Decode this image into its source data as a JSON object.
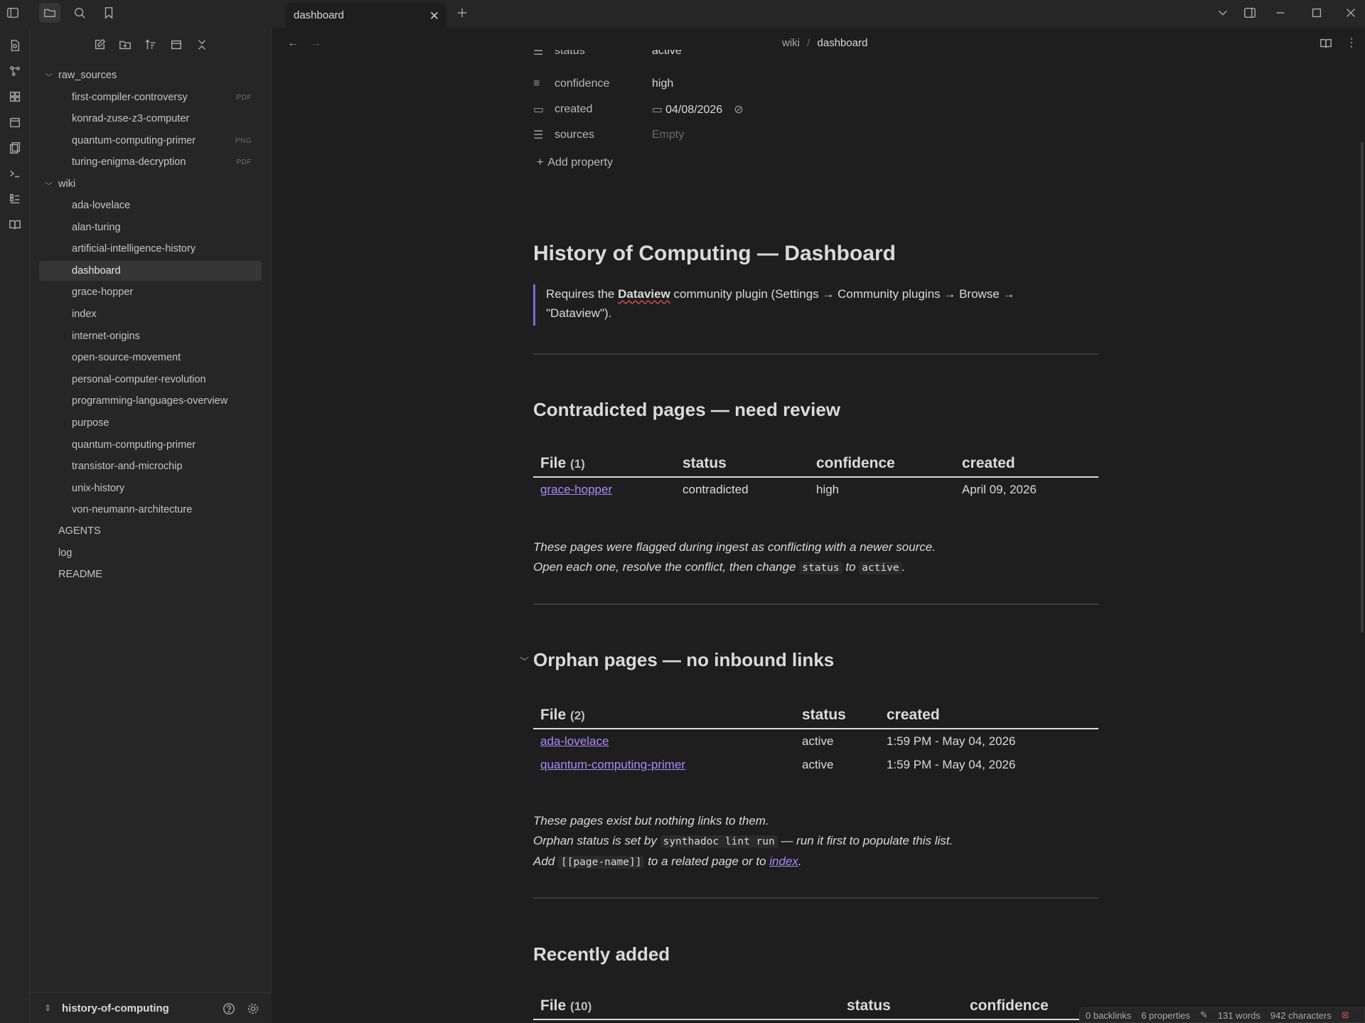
{
  "tabs": [
    {
      "label": "dashboard"
    }
  ],
  "breadcrumb": {
    "folder": "wiki",
    "separator": "/",
    "page": "dashboard"
  },
  "tree": {
    "folders": [
      {
        "name": "raw_sources",
        "items": [
          {
            "label": "first-compiler-controversy",
            "badge": "PDF"
          },
          {
            "label": "konrad-zuse-z3-computer",
            "badge": ""
          },
          {
            "label": "quantum-computing-primer",
            "badge": "PNG"
          },
          {
            "label": "turing-enigma-decryption",
            "badge": "PDF"
          }
        ]
      },
      {
        "name": "wiki",
        "items": [
          {
            "label": "ada-lovelace"
          },
          {
            "label": "alan-turing"
          },
          {
            "label": "artificial-intelligence-history"
          },
          {
            "label": "dashboard"
          },
          {
            "label": "grace-hopper"
          },
          {
            "label": "index"
          },
          {
            "label": "internet-origins"
          },
          {
            "label": "open-source-movement"
          },
          {
            "label": "personal-computer-revolution"
          },
          {
            "label": "programming-languages-overview"
          },
          {
            "label": "purpose"
          },
          {
            "label": "quantum-computing-primer"
          },
          {
            "label": "transistor-and-microchip"
          },
          {
            "label": "unix-history"
          },
          {
            "label": "von-neumann-architecture"
          }
        ]
      }
    ],
    "root_files": [
      "AGENTS",
      "log",
      "README"
    ],
    "active": "dashboard"
  },
  "vault": {
    "name": "history-of-computing"
  },
  "properties": [
    {
      "key": "status",
      "value": "active",
      "icon": "list-icon"
    },
    {
      "key": "confidence",
      "value": "high",
      "icon": "text-icon"
    },
    {
      "key": "created",
      "value": "04/08/2026",
      "icon": "calendar-icon"
    },
    {
      "key": "sources",
      "value": "Empty",
      "icon": "list-icon"
    }
  ],
  "add_property_label": "Add property",
  "doc": {
    "title": "History of Computing — Dashboard",
    "callout": {
      "before": "Requires the ",
      "bold": "Dataview",
      "after": " community plugin (Settings → Community plugins → Browse →",
      "line2": "\"Dataview\")."
    },
    "section_contradicted": {
      "heading": "Contradicted pages — need review",
      "columns": [
        "File",
        "status",
        "confidence",
        "created"
      ],
      "count": "(1)",
      "rows": [
        {
          "file": "grace-hopper",
          "status": "contradicted",
          "confidence": "high",
          "created": "April 09, 2026"
        }
      ],
      "note_line1": "These pages were flagged during ingest as conflicting with a newer source.",
      "note_line2_a": "Open each one, resolve the conflict, then change ",
      "note_code1": "status",
      "note_line2_b": " to ",
      "note_code2": "active",
      "note_line2_c": "."
    },
    "section_orphans": {
      "heading": "Orphan pages — no inbound links",
      "columns": [
        "File",
        "status",
        "created"
      ],
      "count": "(2)",
      "rows": [
        {
          "file": "ada-lovelace",
          "status": "active",
          "created": "1:59 PM - May 04, 2026"
        },
        {
          "file": "quantum-computing-primer",
          "status": "active",
          "created": "1:59 PM - May 04, 2026"
        }
      ],
      "note_line1": "These pages exist but nothing links to them.",
      "note_line2_a": "Orphan status is set by ",
      "note_code1": "synthadoc lint run",
      "note_line2_b": " — run it first to populate this list.",
      "note_line3_a": "Add ",
      "note_code2": "[[page-name]]",
      "note_line3_b": " to a related page or to ",
      "note_link": "index",
      "note_line3_c": "."
    },
    "section_recent": {
      "heading": "Recently added",
      "columns": [
        "File",
        "status",
        "confidence"
      ],
      "count": "(10)"
    }
  },
  "statusbar": {
    "backlinks": "0 backlinks",
    "properties": "6 properties",
    "words": "131 words",
    "characters": "942 characters"
  },
  "colors": {
    "accent": "#a88bfa",
    "bg": "#1e1e1e",
    "panel": "#262626"
  }
}
